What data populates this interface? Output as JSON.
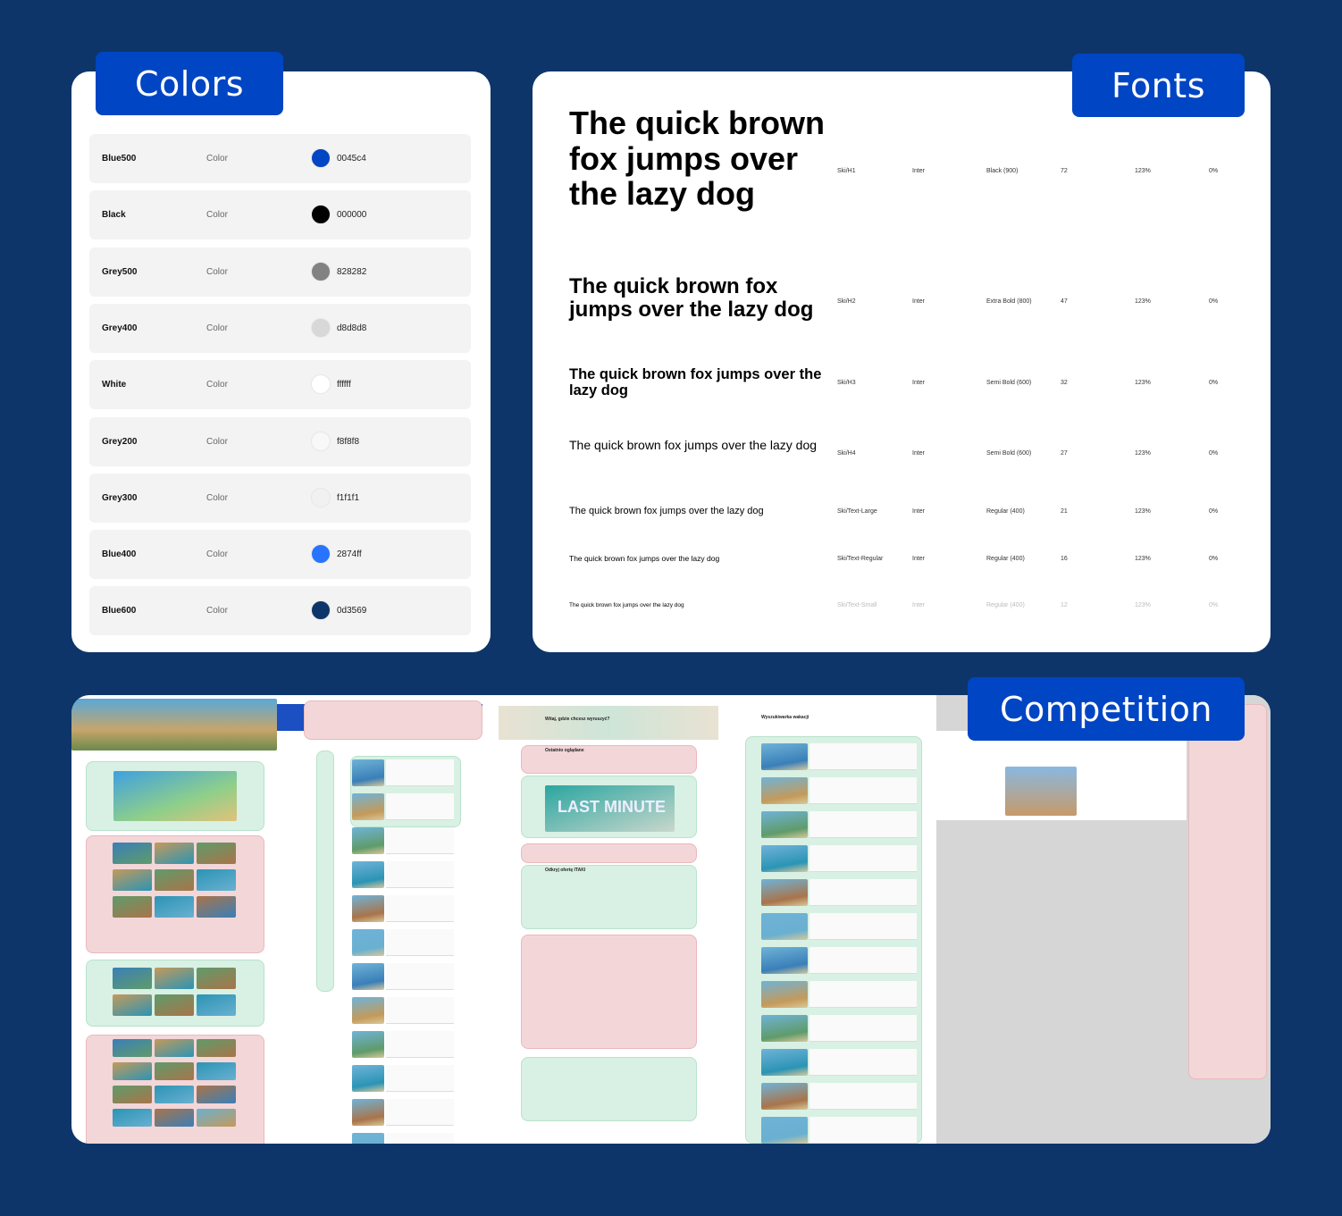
{
  "colors_panel": {
    "tab_label": "Colors",
    "rows": [
      {
        "name": "Blue500",
        "type": "Color",
        "hex": "0045c4",
        "swatch": "#0045c4"
      },
      {
        "name": "Black",
        "type": "Color",
        "hex": "000000",
        "swatch": "#000000"
      },
      {
        "name": "Grey500",
        "type": "Color",
        "hex": "828282",
        "swatch": "#828282"
      },
      {
        "name": "Grey400",
        "type": "Color",
        "hex": "d8d8d8",
        "swatch": "#d8d8d8"
      },
      {
        "name": "White",
        "type": "Color",
        "hex": "ffffff",
        "swatch": "#ffffff"
      },
      {
        "name": "Grey200",
        "type": "Color",
        "hex": "f8f8f8",
        "swatch": "#f8f8f8"
      },
      {
        "name": "Grey300",
        "type": "Color",
        "hex": "f1f1f1",
        "swatch": "#f1f1f1"
      },
      {
        "name": "Blue400",
        "type": "Color",
        "hex": "2874ff",
        "swatch": "#2874ff"
      },
      {
        "name": "Blue600",
        "type": "Color",
        "hex": "0d3569",
        "swatch": "#0d3569"
      }
    ]
  },
  "fonts_panel": {
    "tab_label": "Fonts",
    "rows": [
      {
        "sample": "The quick brown fox jumps over the lazy dog",
        "style": "Ski/H1",
        "family": "Inter",
        "weight": "Black (900)",
        "size": "72",
        "line_height": "123%",
        "letter_spacing": "0%"
      },
      {
        "sample": "The quick brown fox jumps over the lazy dog",
        "style": "Ski/H2",
        "family": "Inter",
        "weight": "Extra Bold (800)",
        "size": "47",
        "line_height": "123%",
        "letter_spacing": "0%"
      },
      {
        "sample": "The quick brown fox jumps over the lazy dog",
        "style": "Ski/H3",
        "family": "Inter",
        "weight": "Semi Bold (600)",
        "size": "32",
        "line_height": "123%",
        "letter_spacing": "0%"
      },
      {
        "sample": "The quick brown fox jumps over the lazy dog",
        "style": "Ski/H4",
        "family": "Inter",
        "weight": "Semi Bold (600)",
        "size": "27",
        "line_height": "123%",
        "letter_spacing": "0%"
      },
      {
        "sample": "The quick brown fox jumps over the lazy dog",
        "style": "Ski/Text-Large",
        "family": "Inter",
        "weight": "Regular (400)",
        "size": "21",
        "line_height": "123%",
        "letter_spacing": "0%"
      },
      {
        "sample": "The quick brown fox jumps over the lazy dog",
        "style": "Ski/Text-Regular",
        "family": "Inter",
        "weight": "Regular (400)",
        "size": "16",
        "line_height": "123%",
        "letter_spacing": "0%"
      },
      {
        "sample": "The quick brown fox jumps over the lazy dog",
        "style": "Ski/Text-Small",
        "family": "Inter",
        "weight": "Regular (400)",
        "size": "12",
        "line_height": "123%",
        "letter_spacing": "0%"
      }
    ]
  },
  "competition_panel": {
    "tab_label": "Competition",
    "labels": {
      "hero_question": "Witaj, gdzie chcesz wyruszyć?",
      "recently_viewed": "Ostatnio oglądane",
      "last_minute": "LAST MINUTE",
      "discover": "Odkryj ofertę ITAKI",
      "search_title": "Wyszukiwarka wakacji"
    }
  },
  "theme": {
    "background": "#0d3569",
    "accent": "#0045c4",
    "section_pink": "#f3d6d8",
    "section_green": "#d8f1e4"
  }
}
